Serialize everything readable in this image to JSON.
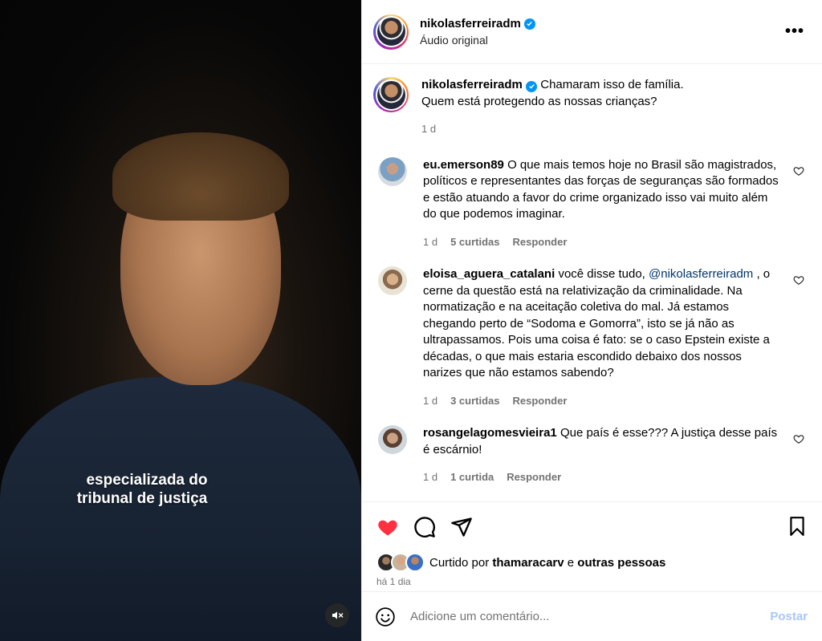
{
  "media": {
    "caption_line1": "especializada do",
    "caption_line2": "tribunal de justiça",
    "mute_icon": "speaker-muted-icon"
  },
  "header": {
    "username": "nikolasferreiradm",
    "verified": true,
    "audio_label": "Áudio original",
    "more_icon": "more-horizontal-icon"
  },
  "post_caption": {
    "username": "nikolasferreiradm",
    "text_line1": "Chamaram isso de família.",
    "text_line2": "Quem está protegendo as nossas crianças?",
    "time": "1 d"
  },
  "comments": [
    {
      "username": "eu.emerson89",
      "text": "O que mais temos hoje no Brasil são magistrados, políticos e representantes das forças de seguranças são formados e estão atuando a favor do crime organizado isso vai muito além do que podemos imaginar.",
      "time": "1 d",
      "likes": "5 curtidas",
      "reply": "Responder"
    },
    {
      "username": "eloisa_aguera_catalani",
      "text_before": "você disse tudo, ",
      "mention": "@nikolasferreiradm",
      "text_after": " , o cerne da questão está na relativização da criminalidade. Na normatização e na aceitação coletiva do mal. Já estamos chegando perto de “Sodoma e Gomorra”, isto se já não as ultrapassamos. Pois uma coisa é fato: se o caso Epstein existe a décadas, o que mais estaria escondido debaixo dos nossos narizes que não estamos sabendo?",
      "time": "1 d",
      "likes": "3 curtidas",
      "reply": "Responder"
    },
    {
      "username": "rosangelagomesvieira1",
      "text": "Que país é esse??? A justiça desse país é escárnio!",
      "time": "1 d",
      "likes": "1 curtida",
      "reply": "Responder"
    }
  ],
  "likes_row": {
    "prefix": "Curtido por",
    "user": "thamaracarv",
    "conj": "e",
    "others": "outras pessoas"
  },
  "ago": "há 1 dia",
  "add_comment": {
    "placeholder": "Adicione um comentário...",
    "post_label": "Postar"
  },
  "colors": {
    "like_red": "#ff3040",
    "verified_blue": "#0095f6",
    "post_button_disabled": "#a8c7fa",
    "mention": "#00376b"
  }
}
